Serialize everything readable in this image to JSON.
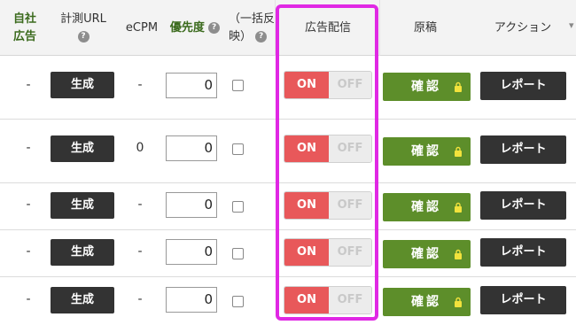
{
  "header": {
    "jisha_koukoku_line1": "自社",
    "jisha_koukoku_line2": "広告",
    "keisoku_url": "計測URL",
    "ecpm": "eCPM",
    "priority": "優先度",
    "ikkatsu_line1": "（一括反",
    "ikkatsu_line2": "映）",
    "ad_delivery": "広告配信",
    "genkou": "原稿",
    "action": "アクション",
    "help_glyph": "?"
  },
  "buttons": {
    "generate": "生成",
    "toggle_on": "ON",
    "toggle_off": "OFF",
    "confirm": "確認",
    "report": "レポート"
  },
  "rows": [
    {
      "jisha": "-",
      "ecpm": "-",
      "priority": "0",
      "bulk_checked": false,
      "delivery": "ON"
    },
    {
      "jisha": "-",
      "ecpm": "0",
      "priority": "0",
      "bulk_checked": false,
      "delivery": "ON"
    },
    {
      "jisha": "-",
      "ecpm": "-",
      "priority": "0",
      "bulk_checked": false,
      "delivery": "ON"
    },
    {
      "jisha": "-",
      "ecpm": "-",
      "priority": "0",
      "bulk_checked": false,
      "delivery": "ON"
    },
    {
      "jisha": "-",
      "ecpm": "-",
      "priority": "0",
      "bulk_checked": false,
      "delivery": "ON"
    }
  ],
  "colors": {
    "toggle_on": "#e8585a",
    "confirm_green": "#5d8e2a",
    "highlight": "#e028e4"
  }
}
